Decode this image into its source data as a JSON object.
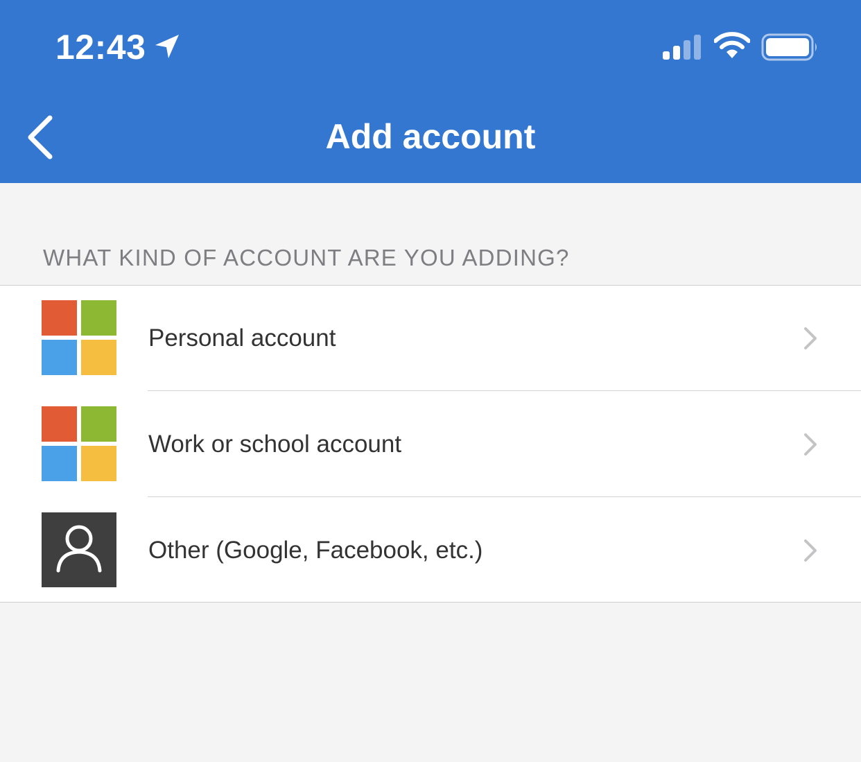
{
  "status_bar": {
    "time": "12:43",
    "location_icon": "location-arrow-icon",
    "signal_icon": "cellular-signal-icon",
    "wifi_icon": "wifi-icon",
    "battery_icon": "battery-icon"
  },
  "header": {
    "title": "Add account",
    "back_icon": "chevron-left-icon",
    "background_color": "#3477d0"
  },
  "section": {
    "title": "WHAT KIND OF ACCOUNT ARE YOU ADDING?"
  },
  "accounts": [
    {
      "label": "Personal account",
      "icon": "microsoft-logo-icon"
    },
    {
      "label": "Work or school account",
      "icon": "microsoft-logo-icon"
    },
    {
      "label": "Other (Google, Facebook, etc.)",
      "icon": "person-icon"
    }
  ],
  "colors": {
    "ms_red": "#e15b34",
    "ms_green": "#8cb834",
    "ms_blue": "#4aa1e8",
    "ms_yellow": "#f5be40"
  }
}
